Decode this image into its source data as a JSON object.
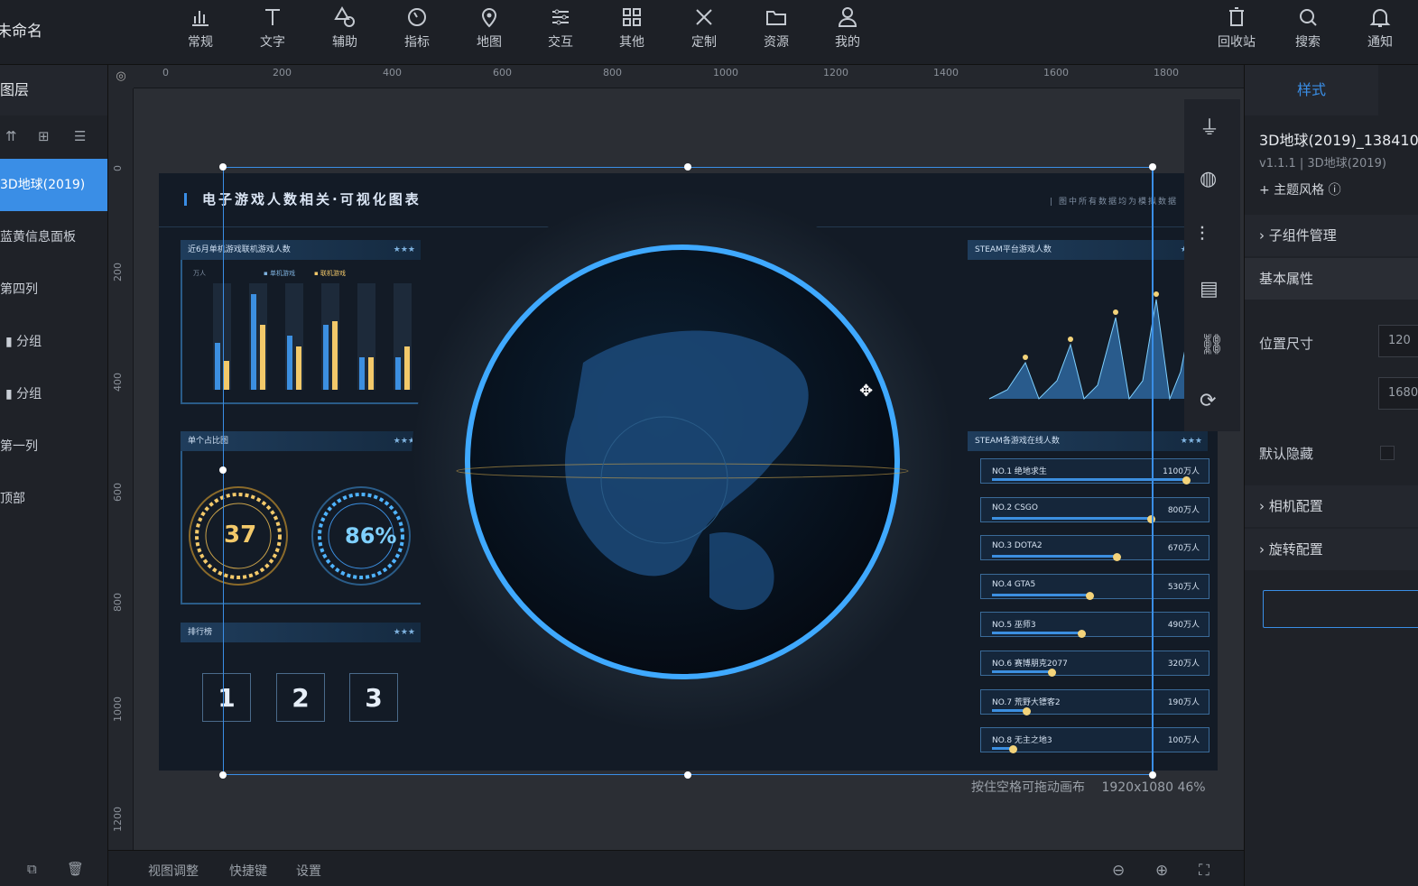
{
  "app": {
    "title": "未命名"
  },
  "toolbar": {
    "items": [
      {
        "label": "常规",
        "icon": "bar-chart-icon"
      },
      {
        "label": "文字",
        "icon": "text-icon"
      },
      {
        "label": "辅助",
        "icon": "shapes-icon"
      },
      {
        "label": "指标",
        "icon": "gauge-icon"
      },
      {
        "label": "地图",
        "icon": "map-pin-icon"
      },
      {
        "label": "交互",
        "icon": "sliders-icon"
      },
      {
        "label": "其他",
        "icon": "grid-icon"
      },
      {
        "label": "定制",
        "icon": "tools-icon"
      },
      {
        "label": "资源",
        "icon": "folder-icon"
      },
      {
        "label": "我的",
        "icon": "user-icon"
      }
    ],
    "right": [
      {
        "label": "回收站",
        "icon": "trash-icon"
      },
      {
        "label": "搜索",
        "icon": "search-icon"
      },
      {
        "label": "通知",
        "icon": "bell-icon"
      }
    ]
  },
  "layers": {
    "title": "图层",
    "items": [
      "3D地球(2019)",
      "蓝黄信息面板",
      "第四列",
      "分组",
      "分组",
      "第一列",
      "顶部"
    ],
    "active_index": 0
  },
  "ruler": {
    "h": [
      "0",
      "200",
      "400",
      "600",
      "800",
      "1000",
      "1200",
      "1400",
      "1600",
      "1800"
    ],
    "v": [
      "0",
      "200",
      "400",
      "600",
      "800",
      "1000",
      "1200"
    ]
  },
  "screen": {
    "title": "电子游戏人数相关·可视化图表",
    "subtitle": "| 图中所有数据均为模拟数据",
    "panels": {
      "bar_title": "近6月单机游戏联机游戏人数",
      "gauge_title": "单个占比图",
      "top_title": "排行榜",
      "steam_title": "STEAM平台游戏人数",
      "rank_title": "STEAM各游戏在线人数",
      "stars": "★★★"
    },
    "gauges": {
      "left": "37",
      "right": "86%"
    },
    "digits": [
      "1",
      "2",
      "3"
    ],
    "bar_legend": [
      "单机游戏",
      "联机游戏"
    ],
    "bar_ylabel": "万人",
    "rankings": [
      {
        "rank": "NO.1",
        "name": "绝地求生",
        "value": "1100万人",
        "pct": 0.95
      },
      {
        "rank": "NO.2",
        "name": "CSGO",
        "value": "800万人",
        "pct": 0.78
      },
      {
        "rank": "NO.3",
        "name": "DOTA2",
        "value": "670万人",
        "pct": 0.61
      },
      {
        "rank": "NO.4",
        "name": "GTA5",
        "value": "530万人",
        "pct": 0.48
      },
      {
        "rank": "NO.5",
        "name": "巫师3",
        "value": "490万人",
        "pct": 0.44
      },
      {
        "rank": "NO.6",
        "name": "赛博朋克2077",
        "value": "320万人",
        "pct": 0.29
      },
      {
        "rank": "NO.7",
        "name": "荒野大镖客2",
        "value": "190万人",
        "pct": 0.17
      },
      {
        "rank": "NO.8",
        "name": "无主之地3",
        "value": "100万人",
        "pct": 0.1
      }
    ]
  },
  "canvas": {
    "hint": "按住空格可拖动画布",
    "size": "1920x1080",
    "zoom": "46%"
  },
  "bottombar": {
    "items": [
      "视图调整",
      "快捷键",
      "设置"
    ]
  },
  "right_panel": {
    "tab": "样式",
    "component_name": "3D地球(2019)_138410",
    "version": "v1.1.1 | 3D地球(2019)",
    "theme": "+ 主题风格",
    "sections": [
      "子组件管理",
      "基本属性",
      "相机配置",
      "旋转配置"
    ],
    "position_label": "位置尺寸",
    "pos_x": "120",
    "width": "1680",
    "hidden_label": "默认隐藏"
  },
  "colors": {
    "accent": "#3a8ee6",
    "gold": "#f3c96a",
    "cyan": "#4fb3ff"
  }
}
